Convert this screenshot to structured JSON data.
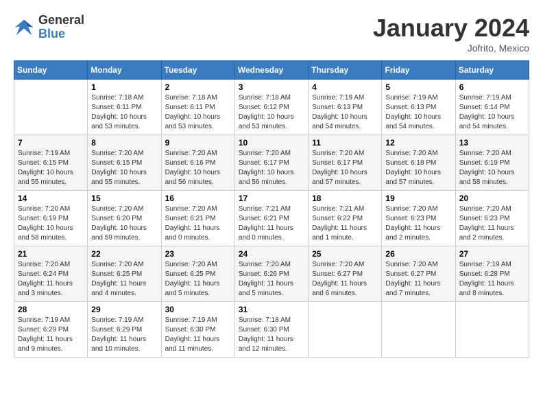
{
  "header": {
    "logo_general": "General",
    "logo_blue": "Blue",
    "month_title": "January 2024",
    "location": "Jofrito, Mexico"
  },
  "days_of_week": [
    "Sunday",
    "Monday",
    "Tuesday",
    "Wednesday",
    "Thursday",
    "Friday",
    "Saturday"
  ],
  "weeks": [
    [
      {
        "day": "",
        "info": ""
      },
      {
        "day": "1",
        "info": "Sunrise: 7:18 AM\nSunset: 6:11 PM\nDaylight: 10 hours\nand 53 minutes."
      },
      {
        "day": "2",
        "info": "Sunrise: 7:18 AM\nSunset: 6:11 PM\nDaylight: 10 hours\nand 53 minutes."
      },
      {
        "day": "3",
        "info": "Sunrise: 7:18 AM\nSunset: 6:12 PM\nDaylight: 10 hours\nand 53 minutes."
      },
      {
        "day": "4",
        "info": "Sunrise: 7:19 AM\nSunset: 6:13 PM\nDaylight: 10 hours\nand 54 minutes."
      },
      {
        "day": "5",
        "info": "Sunrise: 7:19 AM\nSunset: 6:13 PM\nDaylight: 10 hours\nand 54 minutes."
      },
      {
        "day": "6",
        "info": "Sunrise: 7:19 AM\nSunset: 6:14 PM\nDaylight: 10 hours\nand 54 minutes."
      }
    ],
    [
      {
        "day": "7",
        "info": "Sunrise: 7:19 AM\nSunset: 6:15 PM\nDaylight: 10 hours\nand 55 minutes."
      },
      {
        "day": "8",
        "info": "Sunrise: 7:20 AM\nSunset: 6:15 PM\nDaylight: 10 hours\nand 55 minutes."
      },
      {
        "day": "9",
        "info": "Sunrise: 7:20 AM\nSunset: 6:16 PM\nDaylight: 10 hours\nand 56 minutes."
      },
      {
        "day": "10",
        "info": "Sunrise: 7:20 AM\nSunset: 6:17 PM\nDaylight: 10 hours\nand 56 minutes."
      },
      {
        "day": "11",
        "info": "Sunrise: 7:20 AM\nSunset: 6:17 PM\nDaylight: 10 hours\nand 57 minutes."
      },
      {
        "day": "12",
        "info": "Sunrise: 7:20 AM\nSunset: 6:18 PM\nDaylight: 10 hours\nand 57 minutes."
      },
      {
        "day": "13",
        "info": "Sunrise: 7:20 AM\nSunset: 6:19 PM\nDaylight: 10 hours\nand 58 minutes."
      }
    ],
    [
      {
        "day": "14",
        "info": "Sunrise: 7:20 AM\nSunset: 6:19 PM\nDaylight: 10 hours\nand 58 minutes."
      },
      {
        "day": "15",
        "info": "Sunrise: 7:20 AM\nSunset: 6:20 PM\nDaylight: 10 hours\nand 59 minutes."
      },
      {
        "day": "16",
        "info": "Sunrise: 7:20 AM\nSunset: 6:21 PM\nDaylight: 11 hours\nand 0 minutes."
      },
      {
        "day": "17",
        "info": "Sunrise: 7:21 AM\nSunset: 6:21 PM\nDaylight: 11 hours\nand 0 minutes."
      },
      {
        "day": "18",
        "info": "Sunrise: 7:21 AM\nSunset: 6:22 PM\nDaylight: 11 hours\nand 1 minute."
      },
      {
        "day": "19",
        "info": "Sunrise: 7:20 AM\nSunset: 6:23 PM\nDaylight: 11 hours\nand 2 minutes."
      },
      {
        "day": "20",
        "info": "Sunrise: 7:20 AM\nSunset: 6:23 PM\nDaylight: 11 hours\nand 2 minutes."
      }
    ],
    [
      {
        "day": "21",
        "info": "Sunrise: 7:20 AM\nSunset: 6:24 PM\nDaylight: 11 hours\nand 3 minutes."
      },
      {
        "day": "22",
        "info": "Sunrise: 7:20 AM\nSunset: 6:25 PM\nDaylight: 11 hours\nand 4 minutes."
      },
      {
        "day": "23",
        "info": "Sunrise: 7:20 AM\nSunset: 6:25 PM\nDaylight: 11 hours\nand 5 minutes."
      },
      {
        "day": "24",
        "info": "Sunrise: 7:20 AM\nSunset: 6:26 PM\nDaylight: 11 hours\nand 5 minutes."
      },
      {
        "day": "25",
        "info": "Sunrise: 7:20 AM\nSunset: 6:27 PM\nDaylight: 11 hours\nand 6 minutes."
      },
      {
        "day": "26",
        "info": "Sunrise: 7:20 AM\nSunset: 6:27 PM\nDaylight: 11 hours\nand 7 minutes."
      },
      {
        "day": "27",
        "info": "Sunrise: 7:19 AM\nSunset: 6:28 PM\nDaylight: 11 hours\nand 8 minutes."
      }
    ],
    [
      {
        "day": "28",
        "info": "Sunrise: 7:19 AM\nSunset: 6:29 PM\nDaylight: 11 hours\nand 9 minutes."
      },
      {
        "day": "29",
        "info": "Sunrise: 7:19 AM\nSunset: 6:29 PM\nDaylight: 11 hours\nand 10 minutes."
      },
      {
        "day": "30",
        "info": "Sunrise: 7:19 AM\nSunset: 6:30 PM\nDaylight: 11 hours\nand 11 minutes."
      },
      {
        "day": "31",
        "info": "Sunrise: 7:18 AM\nSunset: 6:30 PM\nDaylight: 11 hours\nand 12 minutes."
      },
      {
        "day": "",
        "info": ""
      },
      {
        "day": "",
        "info": ""
      },
      {
        "day": "",
        "info": ""
      }
    ]
  ]
}
